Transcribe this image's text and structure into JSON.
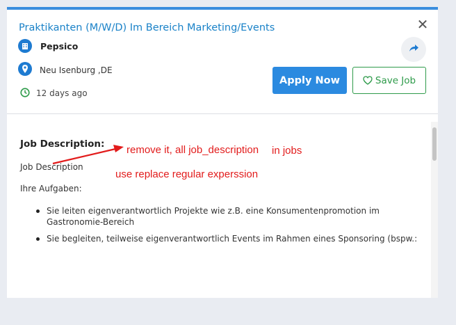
{
  "job": {
    "title": "Praktikanten (M/W/D) Im Bereich Marketing/Events",
    "company": "Pepsico",
    "location": "Neu Isenburg ,DE",
    "posted": "12 days ago"
  },
  "actions": {
    "close_glyph": "✕",
    "apply_label": "Apply Now",
    "save_label": "Save Job"
  },
  "description": {
    "heading": "Job Description:",
    "line1": "Job Description",
    "line2": "Ihre Aufgaben:",
    "bullets": [
      "Sie leiten eigenverantwortlich Projekte wie z.B. eine Konsumentenpromotion im Gastronomie-Bereich",
      "Sie begleiten, teilweise eigenverantwortlich Events im Rahmen eines Sponsoring (bspw.:"
    ]
  },
  "annotations": {
    "note1": "remove it, all job_description",
    "note2": "in jobs",
    "note3": "use replace regular experssion"
  },
  "icons": {
    "company": "building-icon",
    "location": "map-pin-icon",
    "date": "clock-icon",
    "share": "share-icon",
    "save": "heart-icon",
    "close": "close-icon"
  },
  "colors": {
    "title": "#1a82c8",
    "accent": "#2b8ae0",
    "save": "#2e9b4a",
    "annotation": "#e21b1b"
  }
}
